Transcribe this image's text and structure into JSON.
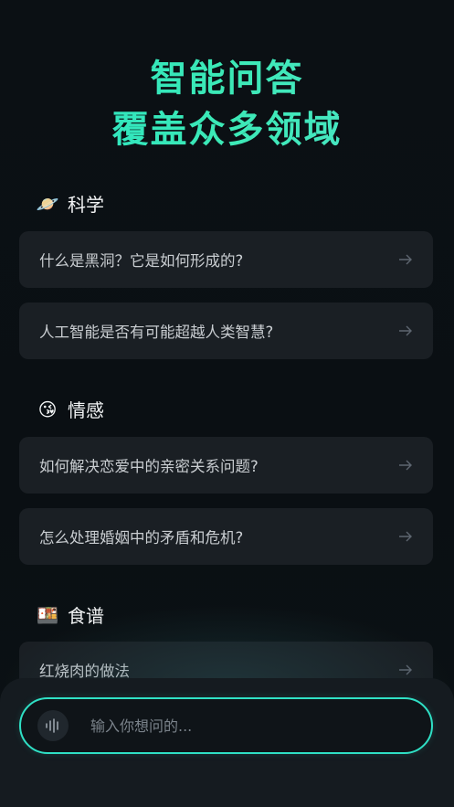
{
  "hero": {
    "line1": "智能问答",
    "line2": "覆盖众多领域"
  },
  "sections": [
    {
      "icon": "saturn-icon",
      "emoji": "🪐",
      "title": "科学",
      "questions": [
        "什么是黑洞？它是如何形成的?",
        "人工智能是否有可能超越人类智慧?"
      ]
    },
    {
      "icon": "kiss-face-icon",
      "emoji": "😘",
      "title": "情感",
      "questions": [
        "如何解决恋爱中的亲密关系问题?",
        "怎么处理婚姻中的矛盾和危机?"
      ]
    },
    {
      "icon": "bento-box-icon",
      "emoji": "🍱",
      "title": "食谱",
      "questions": [
        "红烧肉的做法"
      ]
    }
  ],
  "input": {
    "placeholder": "输入你想问的..."
  },
  "colors": {
    "accent": "#2fe0c5",
    "card_bg": "#1a1f24",
    "page_bg": "#0b1014"
  }
}
